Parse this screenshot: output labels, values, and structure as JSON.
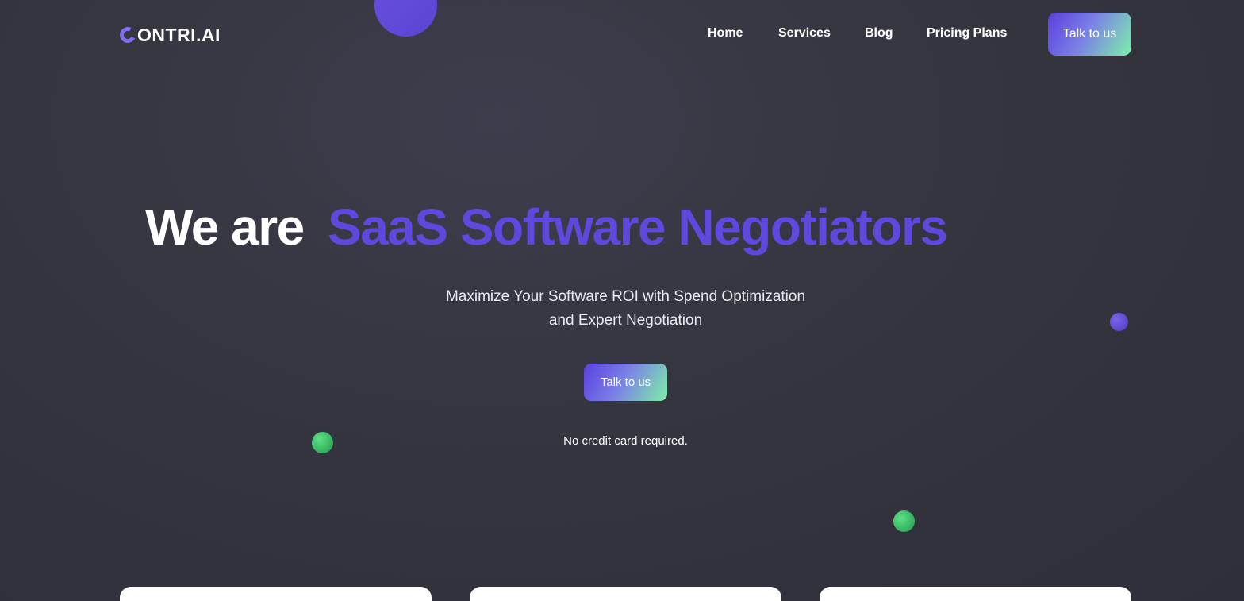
{
  "header": {
    "logo_text": "ONTRI.AI",
    "nav": [
      "Home",
      "Services",
      "Blog",
      "Pricing Plans"
    ],
    "cta_label": "Talk to us"
  },
  "hero": {
    "title_plain": "We are",
    "title_accent": "SaaS Software Negotiators",
    "subtitle_line1": "Maximize Your Software ROI with Spend Optimization",
    "subtitle_line2": "and Expert Negotiation",
    "cta_label": "Talk to us",
    "note": "No credit card required."
  },
  "colors": {
    "accent": "#5d49dd",
    "background": "#383845",
    "gradient_start": "#5a3fe0",
    "gradient_end": "#7ef0a8",
    "decor_green": "#2fbf62"
  }
}
